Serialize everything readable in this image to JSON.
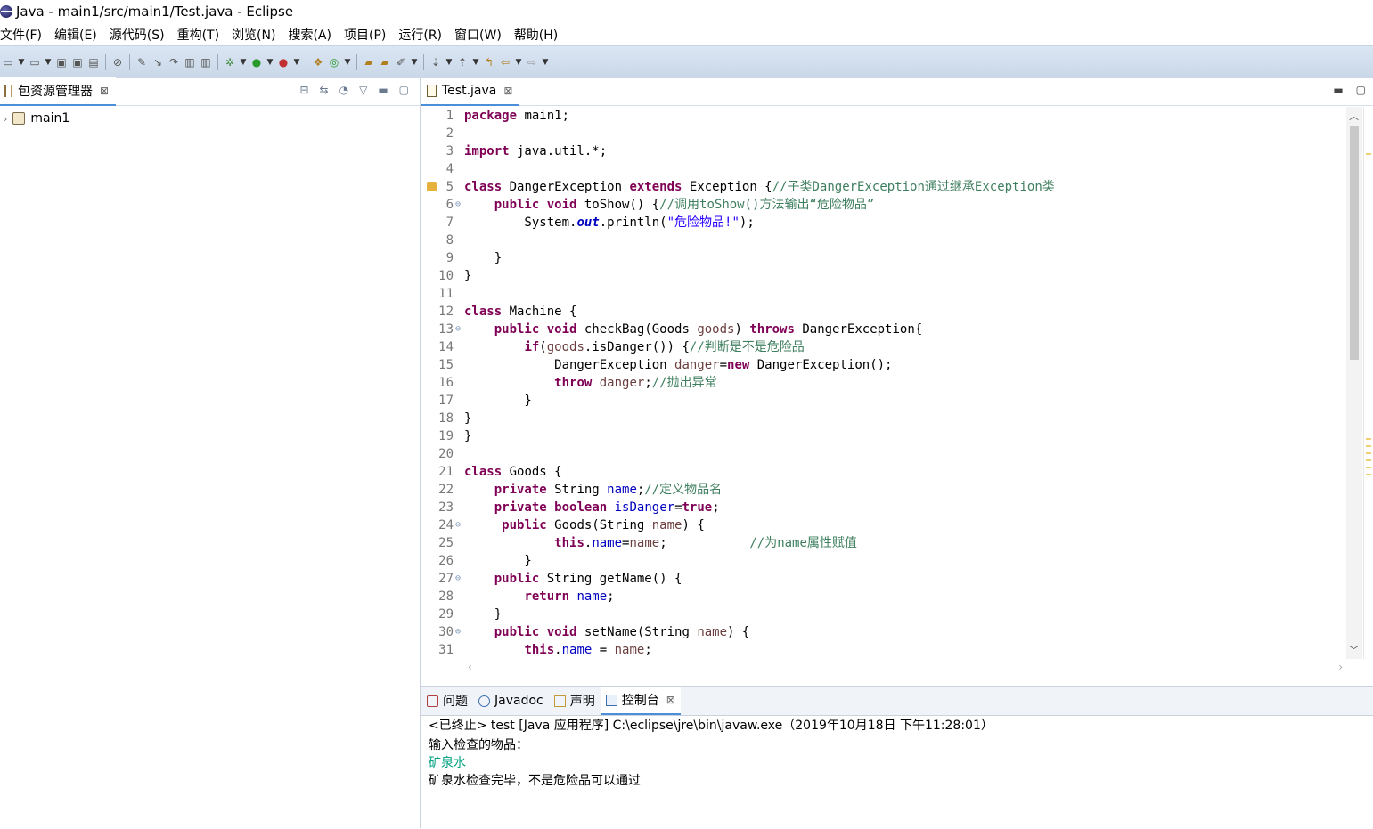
{
  "window": {
    "title": "Java  -  main1/src/main1/Test.java  -  Eclipse"
  },
  "menu": [
    "文件(F)",
    "编辑(E)",
    "源代码(S)",
    "重构(T)",
    "浏览(N)",
    "搜索(A)",
    "项目(P)",
    "运行(R)",
    "窗口(W)",
    "帮助(H)"
  ],
  "left_panel": {
    "tab_label": "包资源管理器",
    "close": "⊠",
    "tree": [
      {
        "label": "main1"
      }
    ]
  },
  "editor": {
    "tab_label": "Test.java",
    "close": "⊠",
    "lines": [
      {
        "n": "1",
        "html": "<span class=\"kw\">package</span> main1;"
      },
      {
        "n": "2",
        "html": ""
      },
      {
        "n": "3",
        "html": "<span class=\"kw\">import</span> java.util.*;"
      },
      {
        "n": "4",
        "html": ""
      },
      {
        "n": "5",
        "marker": true,
        "html": "<span class=\"kw\">class</span> DangerException <span class=\"kw\">extends</span> Exception {<span class=\"cm\">//子类DangerException通过继承Exception类</span>"
      },
      {
        "n": "6",
        "fold": true,
        "html": "    <span class=\"kw\">public</span> <span class=\"kw\">void</span> toShow() {<span class=\"cm\">//调用toShow()方法输出“危险物品”</span>"
      },
      {
        "n": "7",
        "html": "        System.<span class=\"sfld\">out</span>.println(<span class=\"str\">\"危险物品!\"</span>);"
      },
      {
        "n": "8",
        "html": ""
      },
      {
        "n": "9",
        "html": "    }"
      },
      {
        "n": "10",
        "html": "}"
      },
      {
        "n": "11",
        "html": ""
      },
      {
        "n": "12",
        "html": "<span class=\"kw\">class</span> Machine {"
      },
      {
        "n": "13",
        "fold": true,
        "html": "    <span class=\"kw\">public</span> <span class=\"kw\">void</span> checkBag(Goods <span class=\"loc\">goods</span>) <span class=\"kw\">throws</span> DangerException{"
      },
      {
        "n": "14",
        "html": "        <span class=\"kw\">if</span>(<span class=\"loc\">goods</span>.isDanger()) {<span class=\"cm\">//判断是不是危险品</span>"
      },
      {
        "n": "15",
        "html": "            DangerException <span class=\"loc\">danger</span>=<span class=\"kw\">new</span> DangerException();"
      },
      {
        "n": "16",
        "html": "            <span class=\"kw\">throw</span> <span class=\"loc\">danger</span>;<span class=\"cm\">//抛出异常</span>"
      },
      {
        "n": "17",
        "html": "        }"
      },
      {
        "n": "18",
        "html": "}"
      },
      {
        "n": "19",
        "html": "}"
      },
      {
        "n": "20",
        "html": ""
      },
      {
        "n": "21",
        "html": "<span class=\"kw\">class</span> Goods {"
      },
      {
        "n": "22",
        "html": "    <span class=\"kw\">private</span> String <span class=\"fld\">name</span>;<span class=\"cm\">//定义物品名</span>"
      },
      {
        "n": "23",
        "html": "    <span class=\"kw\">private</span> <span class=\"kw\">boolean</span> <span class=\"fld\">isDanger</span>=<span class=\"kw\">true</span>;"
      },
      {
        "n": "24",
        "fold": true,
        "html": "     <span class=\"kw\">public</span> Goods(String <span class=\"loc\">name</span>) {"
      },
      {
        "n": "25",
        "html": "            <span class=\"kw\">this</span>.<span class=\"fld\">name</span>=<span class=\"loc\">name</span>;           <span class=\"cm\">//为name属性赋值</span>"
      },
      {
        "n": "26",
        "html": "        }"
      },
      {
        "n": "27",
        "fold": true,
        "html": "    <span class=\"kw\">public</span> String getName() {"
      },
      {
        "n": "28",
        "html": "        <span class=\"kw\">return</span> <span class=\"fld\">name</span>;"
      },
      {
        "n": "29",
        "html": "    }"
      },
      {
        "n": "30",
        "fold": true,
        "html": "    <span class=\"kw\">public</span> <span class=\"kw\">void</span> setName(String <span class=\"loc\">name</span>) {"
      },
      {
        "n": "31",
        "html": "        <span class=\"kw\">this</span>.<span class=\"fld\">name</span> = <span class=\"loc\">name</span>;"
      }
    ]
  },
  "console": {
    "tabs": [
      {
        "label": "问题",
        "icon": "problems-icon",
        "ico_class": "ico-problem",
        "active": false
      },
      {
        "label": "Javadoc",
        "icon": "javadoc-icon",
        "ico_class": "ico-javadoc",
        "active": false
      },
      {
        "label": "声明",
        "icon": "declaration-icon",
        "ico_class": "ico-decl",
        "active": false
      },
      {
        "label": "控制台",
        "icon": "console-icon",
        "ico_class": "ico-console",
        "active": true
      }
    ],
    "close": "⊠",
    "status": "<已终止> test [Java 应用程序] C:\\eclipse\\jre\\bin\\javaw.exe（2019年10月18日 下午11:28:01）",
    "output": [
      {
        "text": "输入检查的物品：",
        "kind": "out"
      },
      {
        "text": "矿泉水",
        "kind": "in"
      },
      {
        "text": "矿泉水检查完毕，不是危险品可以通过",
        "kind": "out"
      }
    ]
  }
}
